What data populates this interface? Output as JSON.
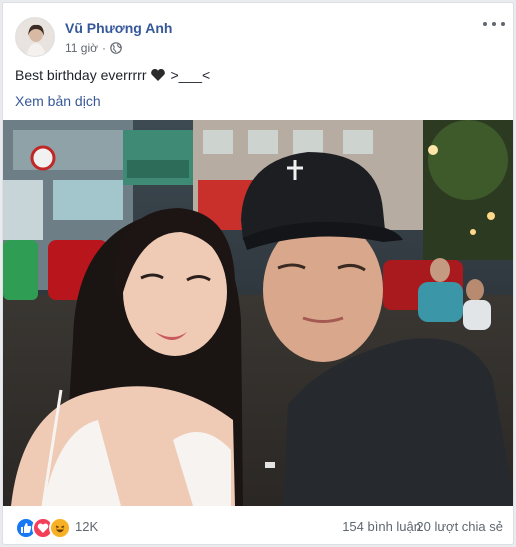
{
  "post": {
    "author": "Vũ Phương Anh",
    "timestamp": "11 giờ",
    "privacy_icon": "globe-icon",
    "text": "Best birthday everrrrr",
    "emoji": "black-heart",
    "text_suffix": ">___<",
    "translate_label": "Xem bản dịch"
  },
  "footer": {
    "reaction_icons": [
      "like-icon",
      "love-icon",
      "haha-icon"
    ],
    "reaction_count": "12K",
    "comments": "154 bình luận",
    "shares": "20 lượt chia sẻ"
  },
  "colors": {
    "link": "#365899",
    "like": "#1877f2",
    "love": "#f33e58",
    "haha": "#f7b125"
  }
}
